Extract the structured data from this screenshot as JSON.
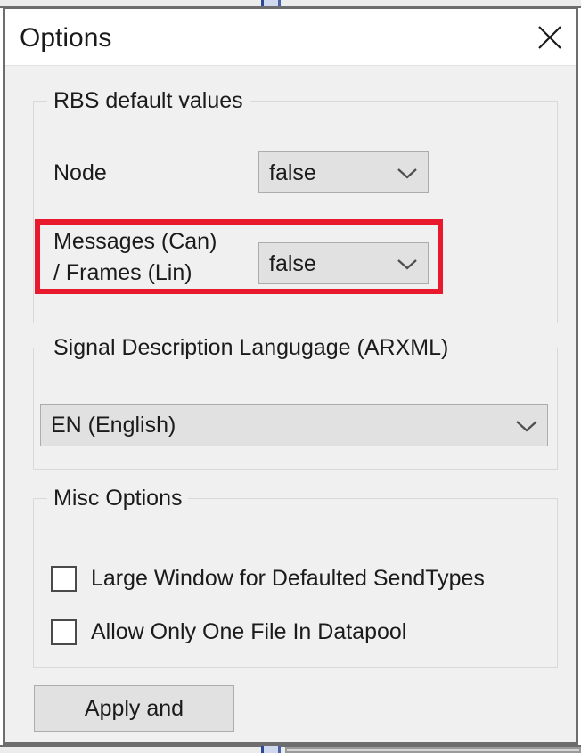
{
  "window": {
    "title": "Options",
    "close_icon": "close-icon"
  },
  "groups": {
    "rbs": {
      "legend": "RBS default values",
      "fields": [
        {
          "label": "Node",
          "value": "false",
          "arrow_icon": "chevron-down-icon"
        },
        {
          "label_line1": "Messages (Can)",
          "label_line2": "/ Frames (Lin)",
          "value": "false",
          "arrow_icon": "chevron-down-icon",
          "highlighted": true,
          "highlight_color": "#e8192c"
        }
      ]
    },
    "arxml": {
      "legend": "Signal Description Langugage (ARXML)",
      "language": {
        "value": "EN (English)",
        "arrow_icon": "chevron-down-icon"
      }
    },
    "misc": {
      "legend": "Misc Options",
      "checkboxes": [
        {
          "label": "Large Window for Defaulted SendTypes",
          "checked": false
        },
        {
          "label": "Allow Only One File In Datapool",
          "checked": false
        }
      ]
    }
  },
  "footer": {
    "apply_button": "Apply and"
  },
  "colors": {
    "window_border": "#6d6d6d",
    "client_background": "#f0f0f0",
    "titlebar_background": "#ffffff",
    "control_background": "#e1e1e1",
    "highlight_red": "#e8192c"
  }
}
